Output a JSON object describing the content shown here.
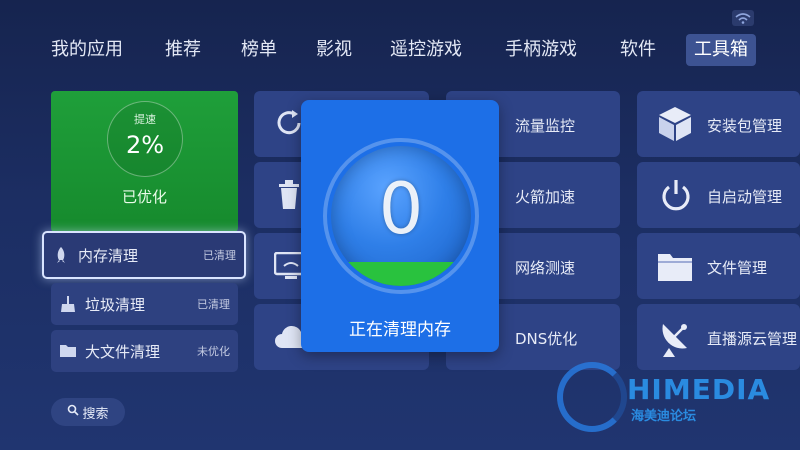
{
  "nav": {
    "items": [
      "我的应用",
      "推荐",
      "榜单",
      "影视",
      "遥控游戏",
      "手柄游戏",
      "软件",
      "工具箱"
    ],
    "active_index": 7
  },
  "status": {
    "wifi_icon": "wifi-icon"
  },
  "optimizer": {
    "speed_label": "提速",
    "speed_value": "2%",
    "status": "已优化"
  },
  "left_actions": [
    {
      "label": "内存清理",
      "status": "已清理",
      "icon": "rocket-icon"
    },
    {
      "label": "垃圾清理",
      "status": "已清理",
      "icon": "broom-icon"
    },
    {
      "label": "大文件清理",
      "status": "未优化",
      "icon": "folder-icon"
    }
  ],
  "search": {
    "label": "搜索",
    "icon": "search-icon"
  },
  "tools": {
    "col3": [
      {
        "label": "流量监控",
        "icon": "traffic-monitor-icon"
      },
      {
        "label": "火箭加速",
        "icon": "rocket-boost-icon"
      },
      {
        "label": "网络测速",
        "icon": "network-speed-icon"
      },
      {
        "label": "DNS优化",
        "icon": "dns-icon"
      }
    ],
    "col4": [
      {
        "label": "安装包管理",
        "icon": "package-box-icon"
      },
      {
        "label": "自启动管理",
        "icon": "power-icon"
      },
      {
        "label": "文件管理",
        "icon": "folder-icon"
      },
      {
        "label": "直播源云管理",
        "icon": "satellite-dish-icon"
      }
    ]
  },
  "popup": {
    "counter": "0",
    "message": "正在清理内存",
    "fill_percent": 17
  },
  "watermark": {
    "brand": "HIMEDIA",
    "sub": "海美迪论坛"
  },
  "colors": {
    "accent_green": "#1f9f3a",
    "popup_blue": "#1d6fe7",
    "tile": "#2e4386"
  }
}
